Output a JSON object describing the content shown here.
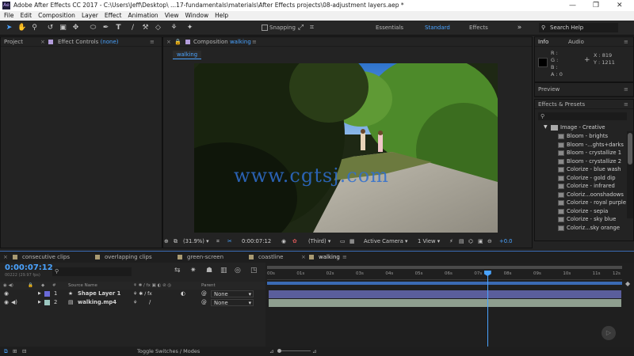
{
  "window": {
    "title": "Adobe After Effects CC 2017 - C:\\Users\\Jeff\\Desktop\\ ...17-fundamentals\\materials\\After Effects projects\\08-adjustment layers.aep *",
    "app_badge": "Ae",
    "minimize": "—",
    "maximize": "❐",
    "close": "✕"
  },
  "menu": [
    "File",
    "Edit",
    "Composition",
    "Layer",
    "Effect",
    "Animation",
    "View",
    "Window",
    "Help"
  ],
  "toolbar": {
    "snapping_label": "Snapping",
    "workspaces": [
      "Essentials",
      "Standard",
      "Effects"
    ],
    "active_workspace": "Standard",
    "search_placeholder": "Search Help"
  },
  "project_panel": {
    "title": "Project"
  },
  "effect_controls": {
    "title": "Effect Controls",
    "subject": "(none)"
  },
  "composition": {
    "title": "Composition",
    "name": "walking",
    "tab_label": "walking",
    "watermark": "www.cgtsj.com"
  },
  "viewer_bar": {
    "zoom": "(31.9%)",
    "timecode": "0:00:07:12",
    "resolution": "(Third)",
    "camera": "Active Camera",
    "views": "1 View",
    "exposure": "+0.0"
  },
  "info_panel": {
    "tabs": [
      "Info",
      "Audio"
    ],
    "r_label": "R :",
    "g_label": "G :",
    "b_label": "B :",
    "a_label": "A :",
    "a_value": "0",
    "x_label": "X : 819",
    "y_label": "Y : 1211"
  },
  "preview_panel": {
    "title": "Preview"
  },
  "effects_presets": {
    "title": "Effects & Presets",
    "folder": "Image - Creative",
    "items": [
      "Bloom - brights",
      "Bloom -...ghts+darks",
      "Bloom - crystallize 1",
      "Bloom - crystallize 2",
      "Colorize - blue wash",
      "Colorize - gold dip",
      "Colorize - infrared",
      "Coloriz...oonshadows",
      "Colorize - royal purple",
      "Colorize - sepia",
      "Colorize - sky blue",
      "Coloriz...sky orange"
    ]
  },
  "timeline": {
    "tabs": [
      {
        "label": "consecutive clips",
        "active": false
      },
      {
        "label": "overlapping clips",
        "active": false
      },
      {
        "label": "green-screen",
        "active": false
      },
      {
        "label": "coastline",
        "active": false
      },
      {
        "label": "walking",
        "active": true
      }
    ],
    "timecode": "0:00:07:12",
    "frame_info": "00222 (29.97 fps)",
    "col_source_name": "Source Name",
    "col_parent": "Parent",
    "col_hash": "#",
    "ruler": [
      "00s",
      "01s",
      "02s",
      "03s",
      "04s",
      "05s",
      "06s",
      "07s",
      "08s",
      "09s",
      "10s",
      "11s",
      "12s"
    ],
    "playhead_fraction": 0.62,
    "layers": [
      {
        "num": "1",
        "name": "Shape Layer 1",
        "parent": "None",
        "label_color": "#6a6ad8",
        "bar_color": "#5a5e9c"
      },
      {
        "num": "2",
        "name": "walking.mp4",
        "parent": "None",
        "label_color": "#9cc7c0",
        "bar_color": "#8e9e8f"
      }
    ]
  },
  "footer": {
    "toggle_label": "Toggle Switches / Modes"
  }
}
